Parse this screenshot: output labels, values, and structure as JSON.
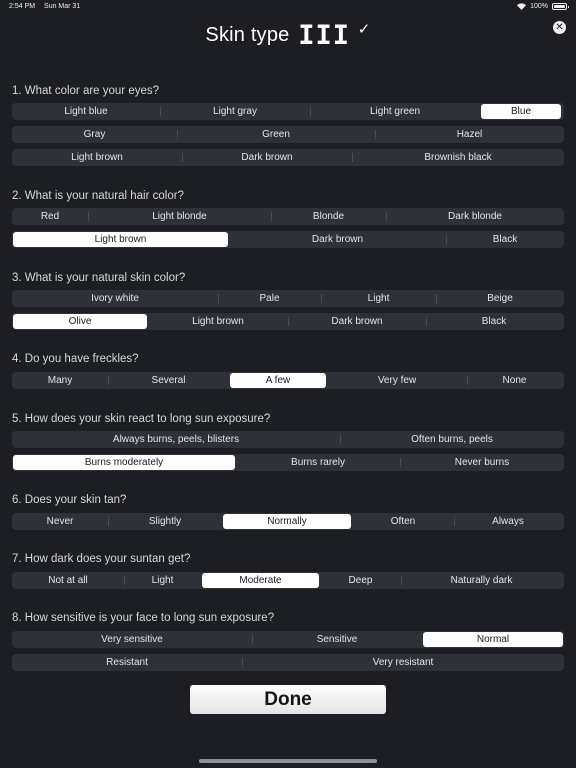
{
  "status": {
    "time": "2:54 PM",
    "date": "Sun Mar 31",
    "battery": "100%"
  },
  "header": {
    "title": "Skin type",
    "skin_type": "III",
    "check": "✓",
    "close": "✕"
  },
  "questions": [
    {
      "text": "1.  What color are your eyes?",
      "rows": [
        {
          "options": [
            {
              "label": "Light blue"
            },
            {
              "label": "Light gray"
            },
            {
              "label": "Light green"
            },
            {
              "label": "Blue",
              "selected": true
            }
          ]
        },
        {
          "options": [
            {
              "label": "Gray"
            },
            {
              "label": "Green"
            },
            {
              "label": "Hazel"
            }
          ]
        },
        {
          "options": [
            {
              "label": "Light brown"
            },
            {
              "label": "Dark brown"
            },
            {
              "label": "Brownish black"
            }
          ]
        }
      ]
    },
    {
      "text": "2. What is your natural hair color?",
      "rows": [
        {
          "options": [
            {
              "label": "Red"
            },
            {
              "label": "Light blonde"
            },
            {
              "label": "Blonde"
            },
            {
              "label": "Dark blonde"
            }
          ]
        },
        {
          "options": [
            {
              "label": "Light brown",
              "selected": true
            },
            {
              "label": "Dark brown"
            },
            {
              "label": "Black"
            }
          ]
        }
      ]
    },
    {
      "text": "3. What is your natural skin color?",
      "rows": [
        {
          "options": [
            {
              "label": "Ivory white"
            },
            {
              "label": "Pale"
            },
            {
              "label": "Light"
            },
            {
              "label": "Beige"
            }
          ]
        },
        {
          "options": [
            {
              "label": "Olive",
              "selected": true
            },
            {
              "label": "Light brown"
            },
            {
              "label": "Dark brown"
            },
            {
              "label": "Black"
            }
          ]
        }
      ]
    },
    {
      "text": "4. Do you have freckles?",
      "rows": [
        {
          "options": [
            {
              "label": "Many"
            },
            {
              "label": "Several"
            },
            {
              "label": "A few",
              "selected": true
            },
            {
              "label": "Very few"
            },
            {
              "label": "None"
            }
          ]
        }
      ]
    },
    {
      "text": "5. How does your skin react to long sun exposure?",
      "rows": [
        {
          "options": [
            {
              "label": "Always burns, peels, blisters"
            },
            {
              "label": "Often burns, peels"
            }
          ]
        },
        {
          "options": [
            {
              "label": "Burns moderately",
              "selected": true
            },
            {
              "label": "Burns rarely"
            },
            {
              "label": "Never burns"
            }
          ]
        }
      ]
    },
    {
      "text": "6. Does your skin tan?",
      "rows": [
        {
          "options": [
            {
              "label": "Never"
            },
            {
              "label": "Slightly"
            },
            {
              "label": "Normally",
              "selected": true
            },
            {
              "label": "Often"
            },
            {
              "label": "Always"
            }
          ]
        }
      ]
    },
    {
      "text": "7.  How dark does your suntan get?",
      "rows": [
        {
          "options": [
            {
              "label": "Not at all"
            },
            {
              "label": "Light"
            },
            {
              "label": "Moderate",
              "selected": true
            },
            {
              "label": "Deep"
            },
            {
              "label": "Naturally dark"
            }
          ]
        }
      ]
    },
    {
      "text": "8. How sensitive is your face to long sun exposure?",
      "rows": [
        {
          "options": [
            {
              "label": "Very sensitive"
            },
            {
              "label": "Sensitive"
            },
            {
              "label": "Normal",
              "selected": true
            }
          ]
        },
        {
          "options": [
            {
              "label": "Resistant"
            },
            {
              "label": "Very resistant"
            }
          ]
        }
      ]
    }
  ],
  "done_label": "Done"
}
